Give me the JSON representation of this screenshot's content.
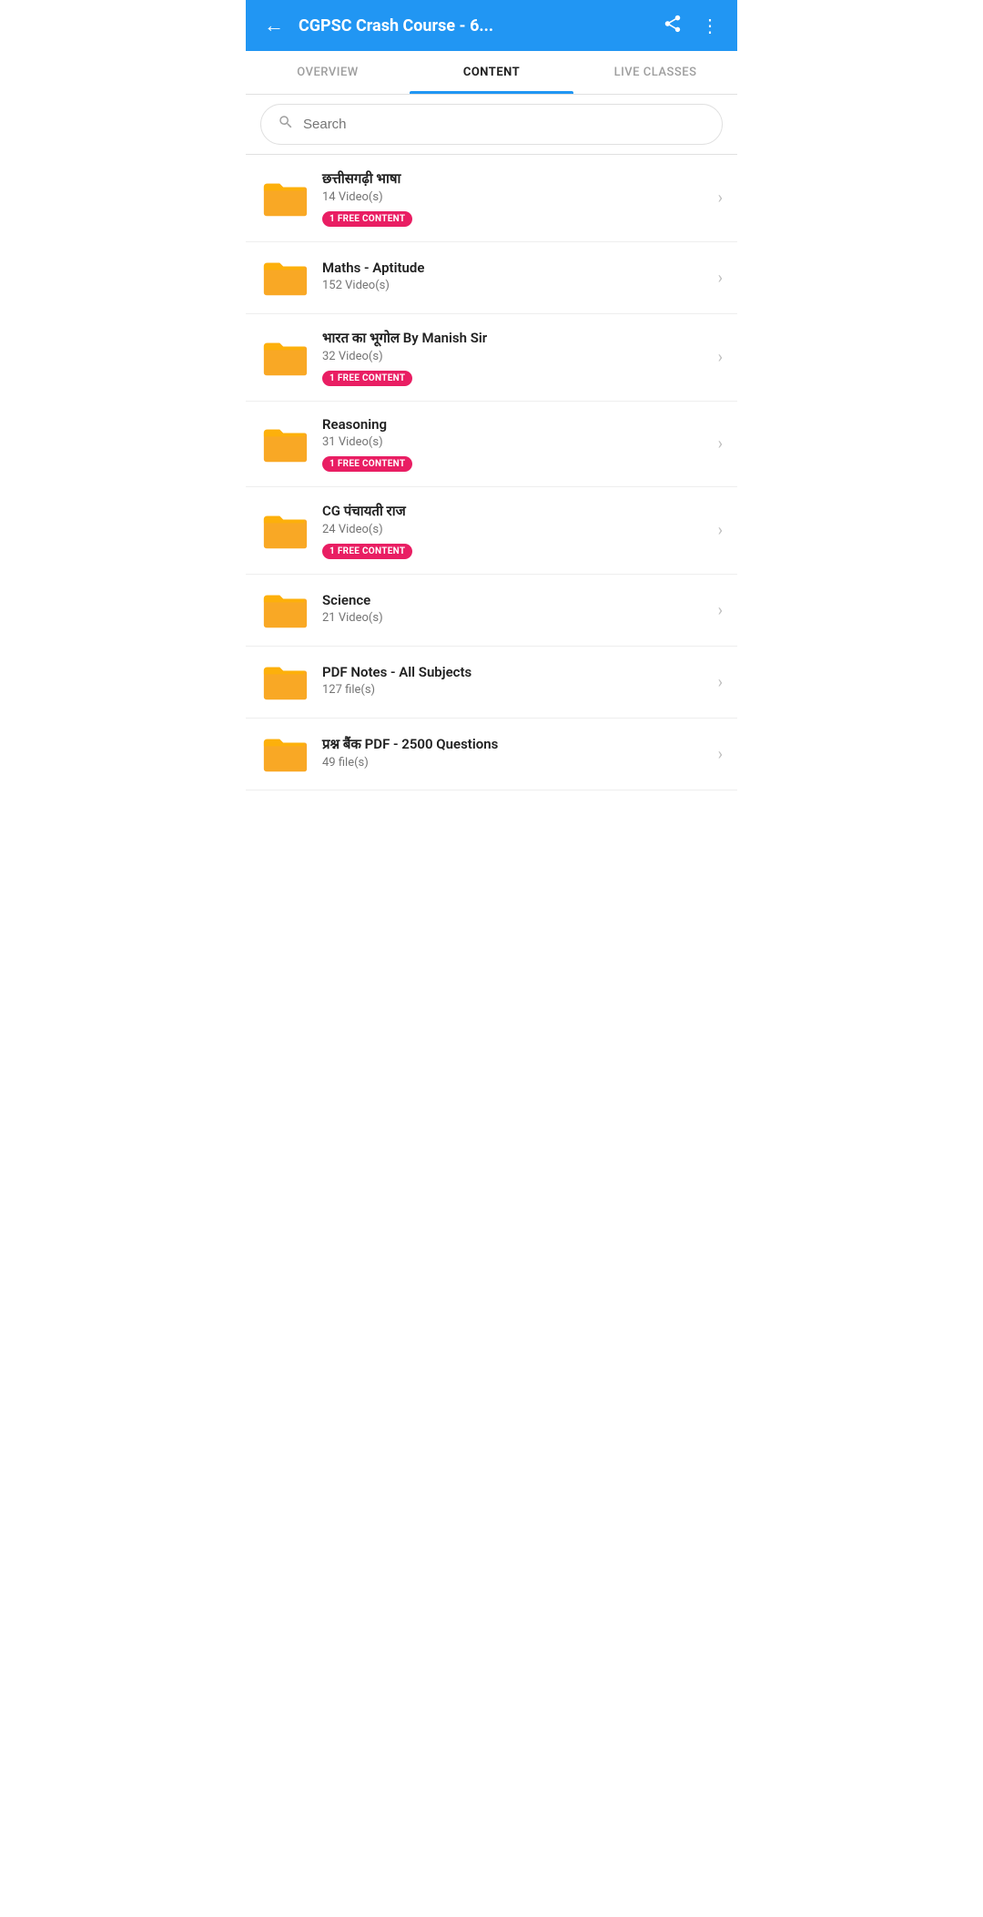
{
  "appBar": {
    "title": "CGPSC Crash Course - 6...",
    "backIcon": "←",
    "shareIcon": "⬆",
    "moreIcon": "⋮"
  },
  "tabs": [
    {
      "id": "overview",
      "label": "OVERVIEW",
      "active": false
    },
    {
      "id": "content",
      "label": "CONTENT",
      "active": true
    },
    {
      "id": "live-classes",
      "label": "LIVE CLASSES",
      "active": false
    }
  ],
  "search": {
    "placeholder": "Search"
  },
  "items": [
    {
      "id": 1,
      "title": "छत्तीसगढ़ी भाषा",
      "subtitle": "14 Video(s)",
      "badge": "1 FREE CONTENT",
      "hasBadge": true
    },
    {
      "id": 2,
      "title": "Maths - Aptitude",
      "subtitle": "152 Video(s)",
      "badge": "",
      "hasBadge": false
    },
    {
      "id": 3,
      "title": "भारत का भूगोल By Manish Sir",
      "subtitle": "32 Video(s)",
      "badge": "1 FREE CONTENT",
      "hasBadge": true
    },
    {
      "id": 4,
      "title": "Reasoning",
      "subtitle": "31 Video(s)",
      "badge": "1 FREE CONTENT",
      "hasBadge": true
    },
    {
      "id": 5,
      "title": "CG पंचायती राज",
      "subtitle": "24 Video(s)",
      "badge": "1 FREE CONTENT",
      "hasBadge": true
    },
    {
      "id": 6,
      "title": "Science",
      "subtitle": "21 Video(s)",
      "badge": "",
      "hasBadge": false
    },
    {
      "id": 7,
      "title": "PDF Notes - All Subjects",
      "subtitle": "127 file(s)",
      "badge": "",
      "hasBadge": false
    },
    {
      "id": 8,
      "title": "प्रश्न बैंक PDF - 2500 Questions",
      "subtitle": "49 file(s)",
      "badge": "",
      "hasBadge": false
    }
  ]
}
